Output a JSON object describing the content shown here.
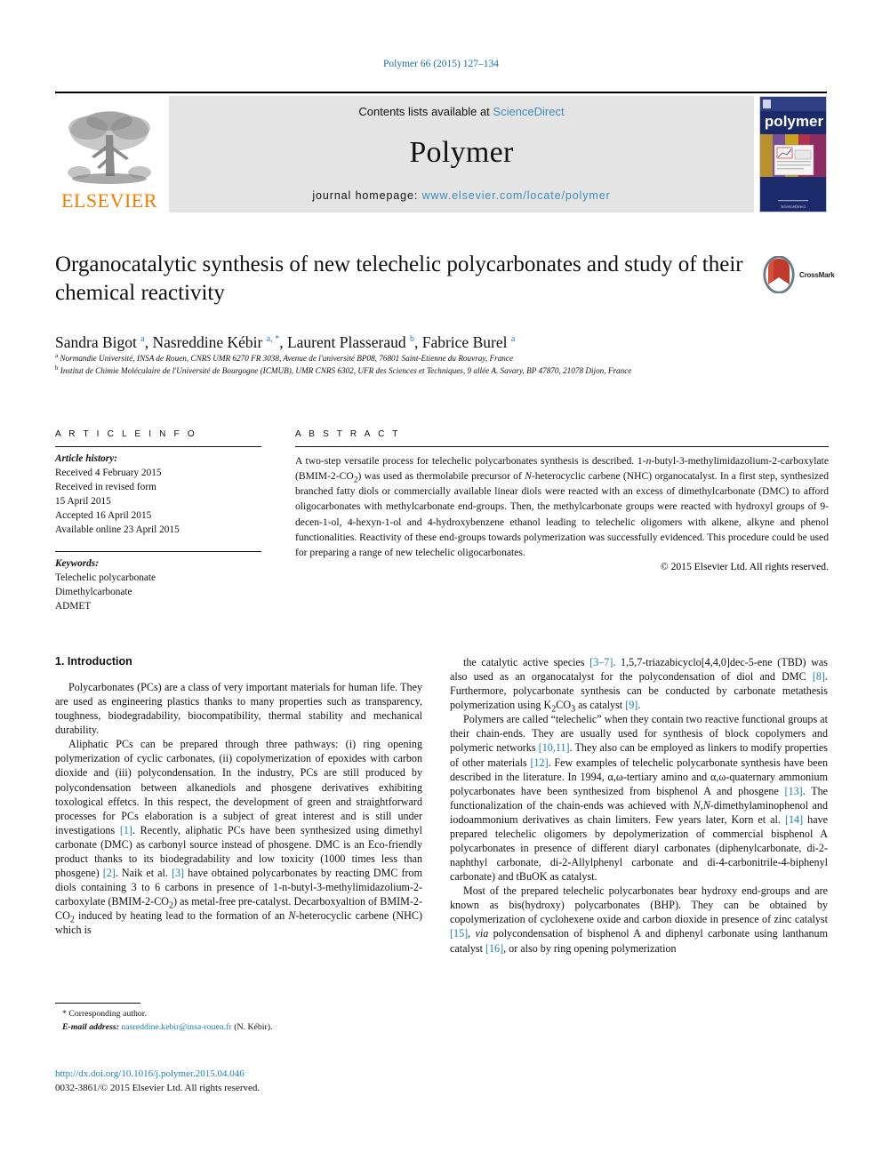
{
  "running_head": "Polymer 66 (2015) 127–134",
  "masthead": {
    "publisher": "ELSEVIER",
    "contents_prefix": "Contents lists available at ",
    "contents_link": "ScienceDirect",
    "journal_title": "Polymer",
    "homepage_prefix": "journal homepage: ",
    "homepage_url": "www.elsevier.com/locate/polymer",
    "cover_word": "polymer",
    "link_color": "#3c8dbc",
    "banner_bg": "#e4e4e4",
    "elsevier_orange": "#ef7d00"
  },
  "article": {
    "title": "Organocatalytic synthesis of new telechelic polycarbonates and study of their chemical reactivity",
    "crossmark_label": "CrossMark",
    "authors_html": "Sandra Bigot <sup>a</sup>, Nasreddine Kébir <sup>a, *</sup>, Laurent Plasseraud <sup>b</sup>, Fabrice Burel <sup>a</sup>",
    "affiliation_a": "Normandie Université, INSA de Rouen, CNRS UMR 6270 FR 3038, Avenue de l'université BP08, 76801 Saint-Etienne du Rouvray, France",
    "affiliation_b": "Institut de Chimie Moléculaire de l'Université de Bourgogne (ICMUB), UMR CNRS 6302, UFR des Sciences et Techniques, 9 allée A. Savary, BP 47870, 21078 Dijon, France"
  },
  "info": {
    "heading": "A R T I C L E  I N F O",
    "history_label": "Article history:",
    "history": [
      "Received 4 February 2015",
      "Received in revised form",
      "15 April 2015",
      "Accepted 16 April 2015",
      "Available online 23 April 2015"
    ],
    "keywords_label": "Keywords:",
    "keywords": [
      "Telechelic polycarbonate",
      "Dimethylcarbonate",
      "ADMET"
    ]
  },
  "abstract": {
    "heading": "A B S T R A C T",
    "text_html": "A two-step versatile process for telechelic polycarbonates synthesis is described. 1-<i>n</i>-butyl-3-methylimidazolium-2-carboxylate (BMIM-2-CO<sub>2</sub>) was used as thermolabile precursor of <i>N</i>-heterocyclic carbene (NHC) organocatalyst. In a first step, synthesized branched fatty diols or commercially available linear diols were reacted with an excess of dimethylcarbonate (DMC) to afford oligocarbonates with methylcarbonate end-groups. Then, the methylcarbonate groups were reacted with hydroxyl groups of 9-decen-1-ol, 4-hexyn-1-ol and 4-hydroxybenzene ethanol leading to telechelic oligomers with alkene, alkyne and phenol functionalities. Reactivity of these end-groups towards polymerization was successfully evidenced. This procedure could be used for preparing a range of new telechelic oligocarbonates.",
    "copyright": "© 2015 Elsevier Ltd. All rights reserved."
  },
  "body": {
    "section_title": "1. Introduction",
    "left_paragraphs_html": [
      "Polycarbonates (PCs) are a class of very important materials for human life. They are used as engineering plastics thanks to many properties such as transparency, toughness, biodegradability, biocompatibility, thermal stability and mechanical durability.",
      "Aliphatic PCs can be prepared through three pathways: (i) ring opening polymerization of cyclic carbonates, (ii) copolymerization of epoxides with carbon dioxide and (iii) polycondensation. In the industry, PCs are still produced by polycondensation between alkanediols and phosgene derivatives exhibiting toxological effetcs. In this respect, the development of green and straightforward processes for PCs elaboration is a subject of great interest and is still under investigations <span class=\"ref\">[1]</span>. Recently, aliphatic PCs have been synthesized using dimethyl carbonate (DMC) as carbonyl source instead of phosgene. DMC is an Eco-friendly product thanks to its biodegradability and low toxicity (1000 times less than phosgene) <span class=\"ref\">[2]</span>. Naik et al. <span class=\"ref\">[3]</span> have obtained polycarbonates by reacting DMC from diols containing 3 to 6 carbons in presence of 1-n-butyl-3-methylimidazolium-2-carboxylate (BMIM-2-CO<sub>2</sub>) as metal-free pre-catalyst. Decarboxyaltion of BMIM-2-CO<sub>2</sub> induced by heating lead to the formation of an <i>N</i>-heterocyclic carbene (NHC) which is"
    ],
    "right_paragraphs_html": [
      "the catalytic active species <span class=\"ref\">[3–7]</span>. 1,5,7-triazabicyclo[4,4,0]dec-5-ene (TBD) was also used as an organocatalyst for the polycondensation of diol and DMC <span class=\"ref\">[8]</span>. Furthermore, polycarbonate synthesis can be conducted by carbonate metathesis polymerization using K<sub>2</sub>CO<sub>3</sub> as catalyst <span class=\"ref\">[9]</span>.",
      "Polymers are called “telechelic” when they contain two reactive functional groups at their chain-ends. They are usually used for synthesis of block copolymers and polymeric networks <span class=\"ref\">[10,11]</span>. They also can be employed as linkers to modify properties of other materials <span class=\"ref\">[12]</span>. Few examples of telechelic polycarbonate synthesis have been described in the literature. In 1994, α,ω-tertiary amino and α,ω-quaternary ammonium polycarbonates have been synthesized from bisphenol A and phosgene <span class=\"ref\">[13]</span>. The functionalization of the chain-ends was achieved with <i>N,N</i>-dimethylaminophenol and iodoammonium derivatives as chain limiters. Few years later, Korn et al. <span class=\"ref\">[14]</span> have prepared telechelic oligomers by depolymerization of commercial bisphenol A polycarbonates in presence of different diaryl carbonates (diphenylcarbonate, di-2-naphthyl carbonate, di-2-Allylphenyl carbonate and di-4-carbonitrile-4-biphenyl carbonate) and tBuOK as catalyst.",
      "Most of the prepared telechelic polycarbonates bear hydroxy end-groups and are known as bis(hydroxy) polycarbonates (BHP). They can be obtained by copolymerization of cyclohexene oxide and carbon dioxide in presence of zinc catalyst <span class=\"ref\">[15]</span>, <i>via</i> polycondensation of bisphenol A and diphenyl carbonate using lanthanum catalyst <span class=\"ref\">[16]</span>, or also by ring opening polymerization"
    ]
  },
  "footnote": {
    "corresponding": "* Corresponding author.",
    "email_label": "E-mail address:",
    "email": "nasreddine.kebir@insa-rouen.fr",
    "email_suffix": "(N. Kébir)."
  },
  "footer": {
    "doi": "http://dx.doi.org/10.1016/j.polymer.2015.04.046",
    "issn_line": "0032-3861/© 2015 Elsevier Ltd. All rights reserved."
  }
}
